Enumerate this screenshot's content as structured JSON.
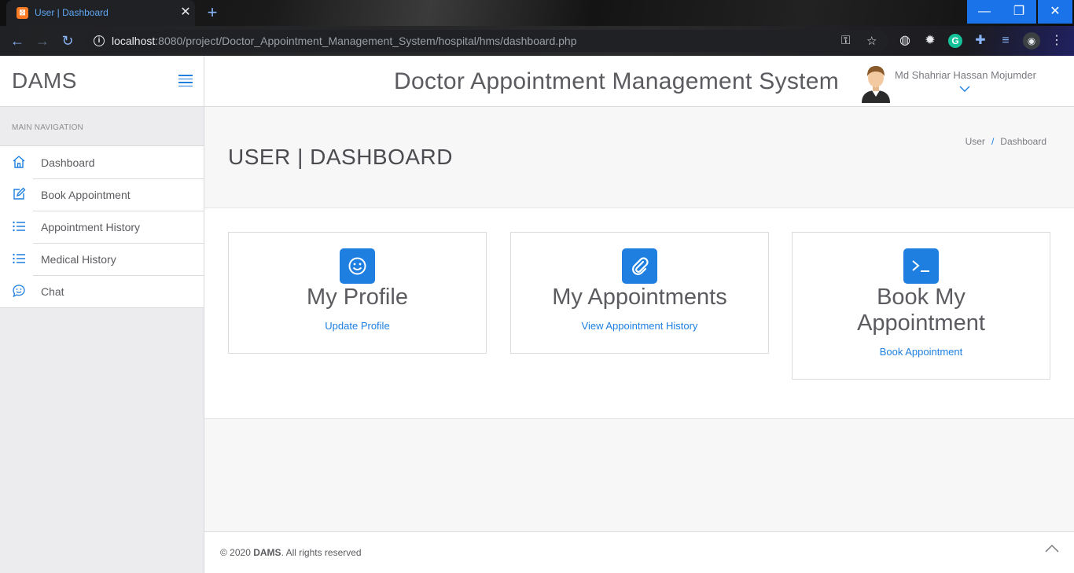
{
  "browser": {
    "tab_title": "User | Dashboard",
    "tab_close": "✕",
    "new_tab": "+",
    "url_host": "localhost",
    "url_rest": ":8080/project/Doctor_Appointment_Management_System/hospital/hms/dashboard.php",
    "window_min": "—",
    "window_max": "❐",
    "window_close": "✕"
  },
  "sidebar": {
    "brand": "DAMS",
    "nav_heading": "MAIN NAVIGATION",
    "items": [
      {
        "label": "Dashboard",
        "icon": "home-icon"
      },
      {
        "label": "Book Appointment",
        "icon": "edit-icon"
      },
      {
        "label": "Appointment History",
        "icon": "list-icon"
      },
      {
        "label": "Medical History",
        "icon": "list-icon"
      },
      {
        "label": "Chat",
        "icon": "chat-icon"
      }
    ]
  },
  "header": {
    "title": "Doctor Appointment Management System",
    "user_name": "Md Shahriar Hassan Mojumder"
  },
  "page": {
    "title": "USER | DASHBOARD",
    "breadcrumb": [
      "User",
      "Dashboard"
    ]
  },
  "cards": [
    {
      "title": "My Profile",
      "link": "Update Profile",
      "icon": "smile-icon"
    },
    {
      "title": "My Appointments",
      "link": "View Appointment History",
      "icon": "paperclip-icon"
    },
    {
      "title": "Book My Appointment",
      "link": "Book Appointment",
      "icon": "terminal-icon"
    }
  ],
  "footer": {
    "year": "© 2020",
    "brand": "DAMS",
    "rights": ". All rights reserved"
  },
  "colors": {
    "accent": "#1e7fe0",
    "text": "#5b5b60",
    "sidebar_bg": "#ececee"
  }
}
